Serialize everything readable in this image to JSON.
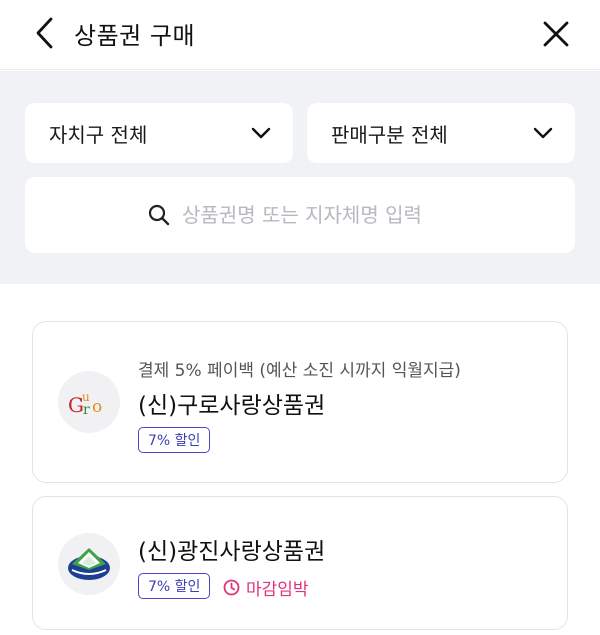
{
  "header": {
    "title": "상품권 구매",
    "back_icon": "chevron-left-icon",
    "close_icon": "close-icon"
  },
  "filters": {
    "district": {
      "selected": "자치구 전체"
    },
    "sales_type": {
      "selected": "판매구분 전체"
    }
  },
  "search": {
    "placeholder": "상품권명 또는 지자체명 입력",
    "value": ""
  },
  "vouchers": [
    {
      "description": "결제 5% 페이백 (예산 소진 시까지 익월지급)",
      "name": "(신)구로사랑상품권",
      "discount": "7% 할인",
      "logo_text": "Guro"
    },
    {
      "name": "(신)광진사랑상품권",
      "discount": "7% 할인",
      "deadline": "마감임박"
    }
  ],
  "colors": {
    "badge": "#3f3db8",
    "deadline": "#e0347a",
    "background": "#f1f2f6"
  }
}
